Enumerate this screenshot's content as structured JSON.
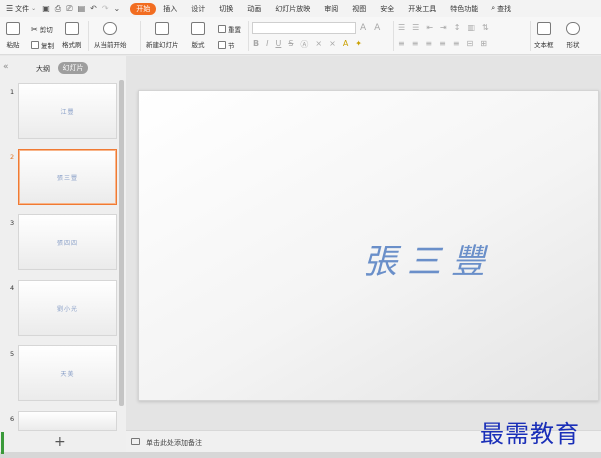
{
  "menubar": {
    "file_label": "文件",
    "tabs": [
      "开始",
      "插入",
      "设计",
      "切换",
      "动画",
      "幻灯片放映",
      "审阅",
      "视图",
      "安全",
      "开发工具",
      "特色功能"
    ],
    "active_tab": "开始",
    "search_label": "查找"
  },
  "ribbon": {
    "paste": "粘贴",
    "cut": "剪切",
    "copy": "复制",
    "format_painter": "格式刷",
    "play_from_current": "从当前开始",
    "new_slide": "新建幻灯片",
    "layout": "版式",
    "reset": "重置",
    "section": "节",
    "font_size_up": "A",
    "font_size_down": "A",
    "bold": "B",
    "italic": "I",
    "underline": "U",
    "strike": "S",
    "textbox": "文本框",
    "shape": "形状"
  },
  "leftpanel": {
    "outline_tab": "大纲",
    "slides_tab": "幻灯片",
    "slides": [
      {
        "num": "1",
        "text": "江豐"
      },
      {
        "num": "2",
        "text": "張三豐"
      },
      {
        "num": "3",
        "text": "張四四"
      },
      {
        "num": "4",
        "text": "劉小光"
      },
      {
        "num": "5",
        "text": "天美"
      },
      {
        "num": "6",
        "text": ""
      }
    ],
    "selected_index": 1,
    "add_slide": "+"
  },
  "editor": {
    "slide_title": "張三豐"
  },
  "notes": {
    "placeholder": "单击此处添加备注"
  },
  "watermark": "最需教育",
  "colors": {
    "accent": "#f26d21",
    "title_blue": "#6a8fc9",
    "watermark_blue": "#1a2fb8"
  }
}
